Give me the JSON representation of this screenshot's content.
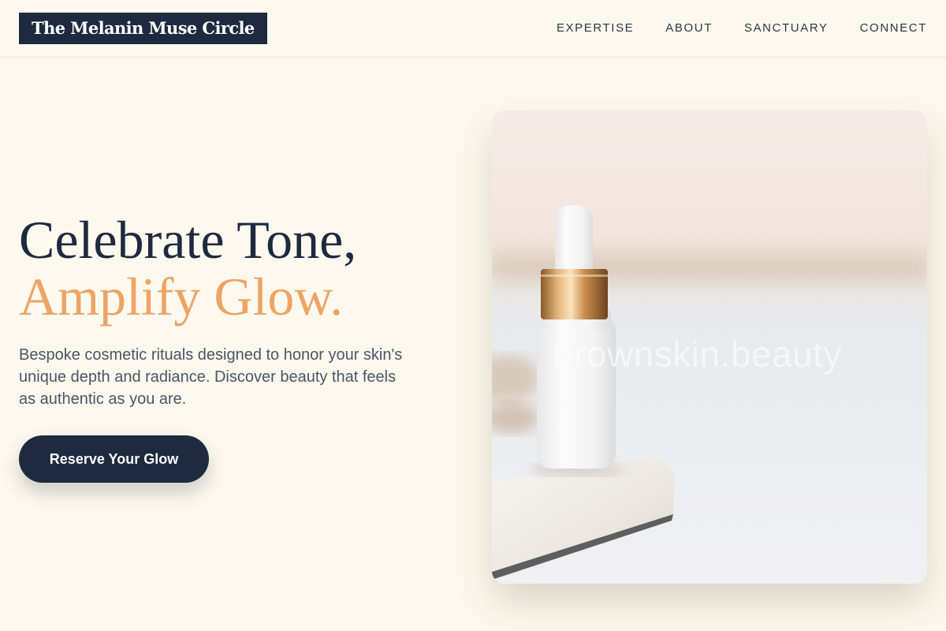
{
  "header": {
    "logo": "The Melanin Muse Circle",
    "nav": [
      {
        "label": "EXPERTISE"
      },
      {
        "label": "ABOUT"
      },
      {
        "label": "SANCTUARY"
      },
      {
        "label": "CONNECT"
      }
    ]
  },
  "hero": {
    "title_line1": "Celebrate Tone,",
    "title_line2": "Amplify Glow.",
    "description": "Bespoke cosmetic rituals designed to honor your skin's unique depth and radiance. Discover beauty that feels as authentic as you are.",
    "cta_label": "Reserve Your Glow"
  },
  "photo": {
    "watermark": "brownskin.beauty",
    "subject": "serum-dropper-bottle-image"
  },
  "colors": {
    "background": "#fdf9ee",
    "navy": "#1e2a3f",
    "accent": "#eea465",
    "body_text": "#4a5568"
  }
}
